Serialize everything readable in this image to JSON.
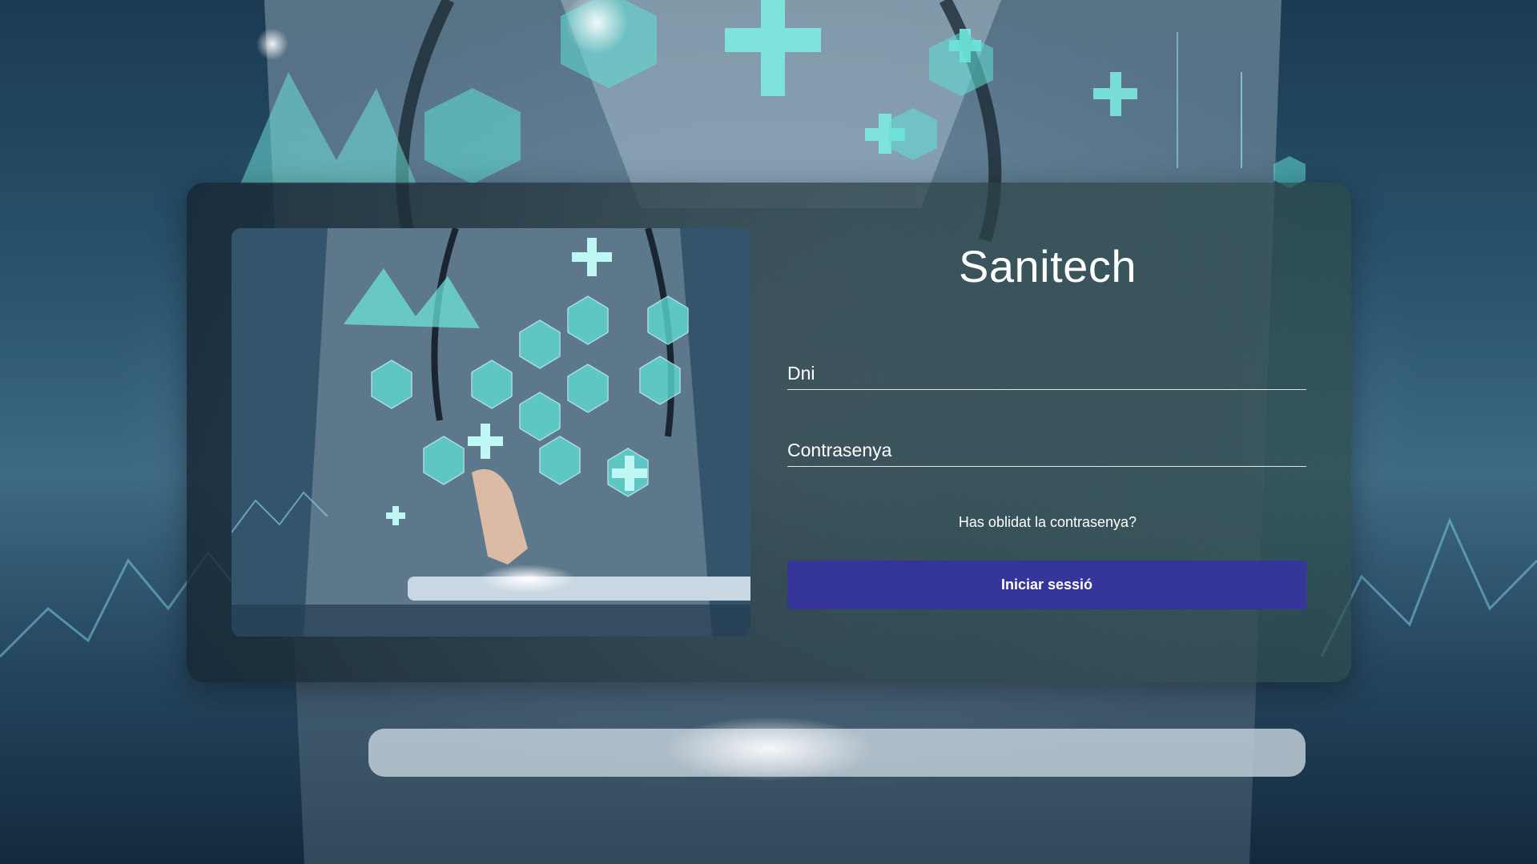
{
  "app": {
    "title": "Sanitech"
  },
  "login_form": {
    "dni_placeholder": "Dni",
    "password_placeholder": "Contrasenya",
    "forgot_password_label": "Has oblidat la contrasenya?",
    "submit_label": "Iniciar sessió"
  },
  "colors": {
    "button_bg": "#35359a",
    "text": "#ffffff",
    "accent_cyan": "#5fe0d6"
  },
  "images": {
    "background": "doctor-with-tablet-medical-icons",
    "card_illustration": "doctor-touching-tablet-hexagon-medical-icons"
  }
}
